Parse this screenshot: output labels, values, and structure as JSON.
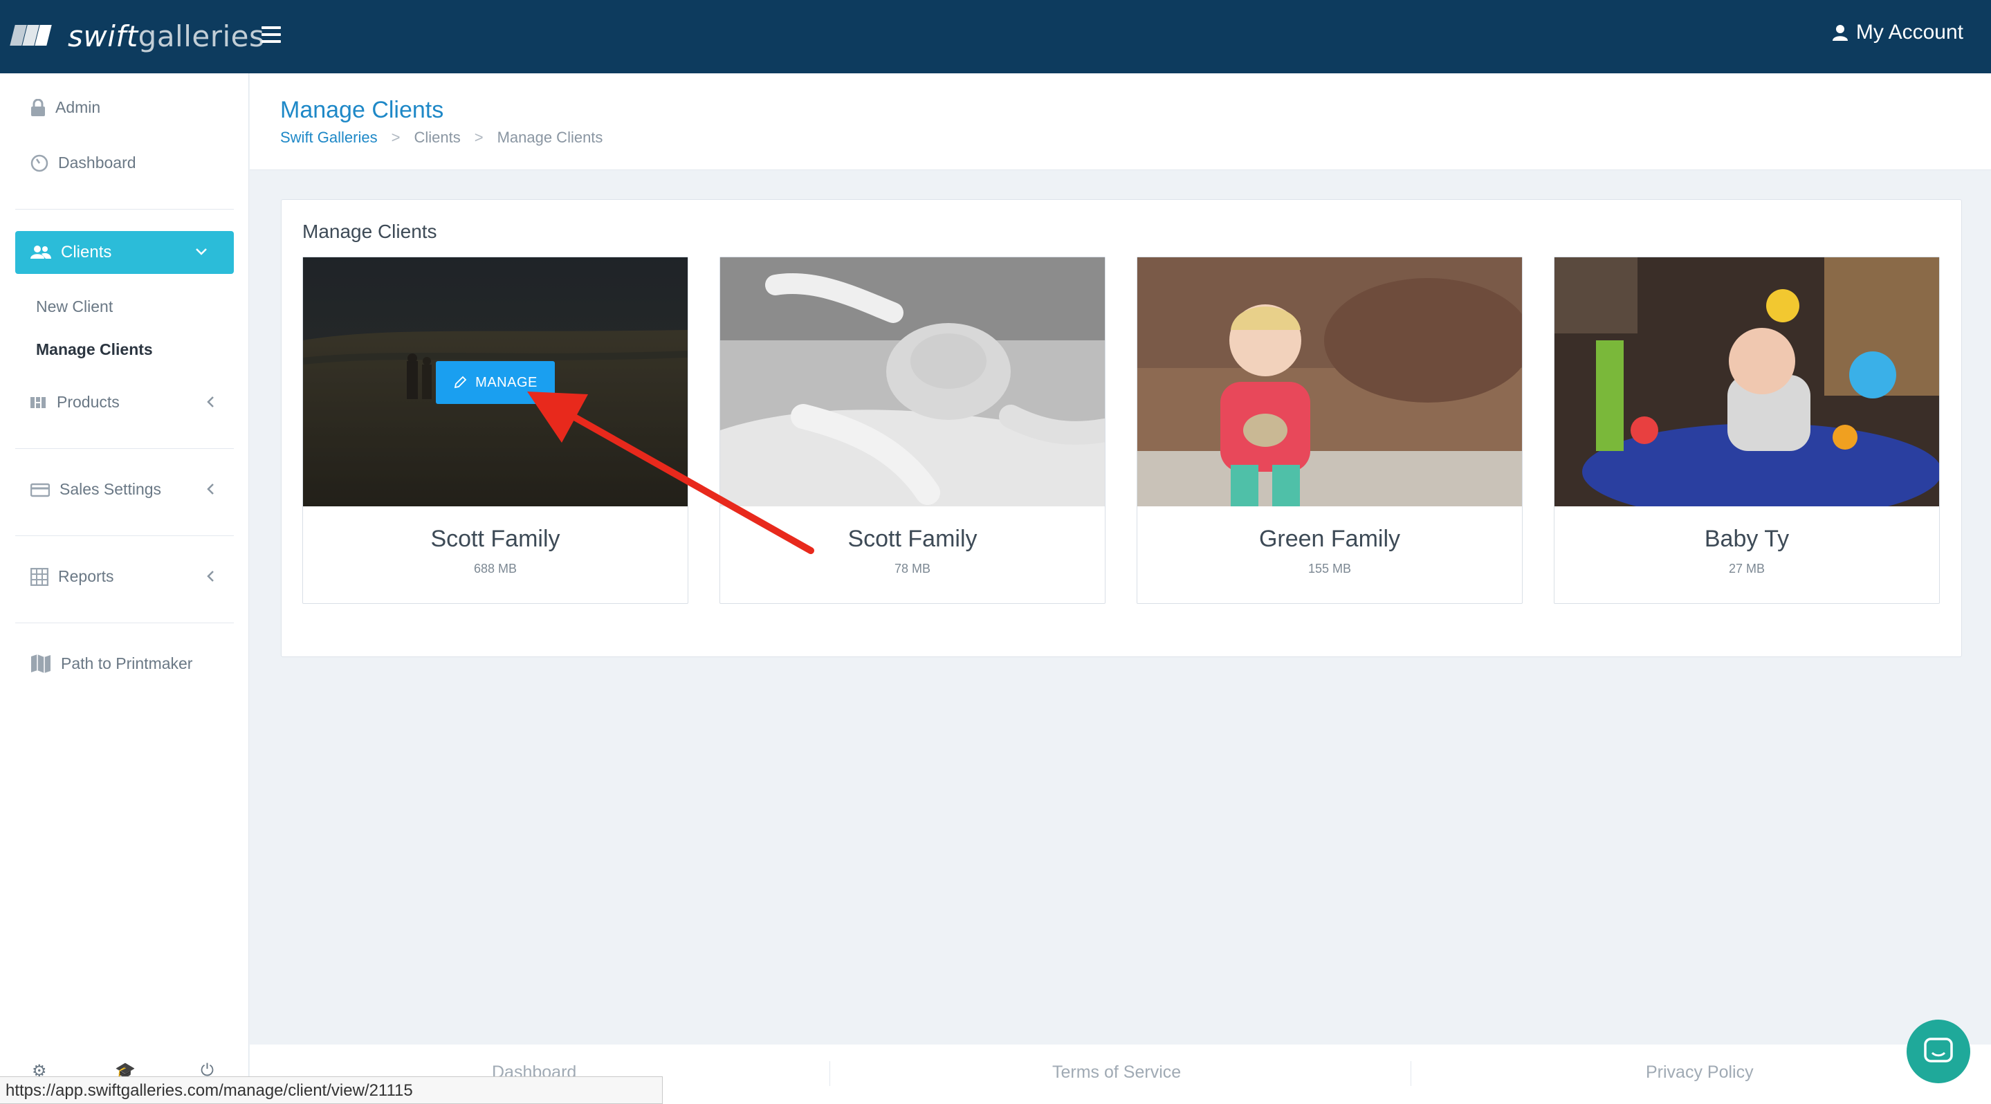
{
  "app": {
    "logo_bold": "swift",
    "logo_light": "galleries",
    "account_label": "My Account"
  },
  "sidebar": {
    "admin": "Admin",
    "dashboard": "Dashboard",
    "clients": "Clients",
    "new_client": "New Client",
    "manage_clients": "Manage Clients",
    "products": "Products",
    "sales_settings": "Sales Settings",
    "reports": "Reports",
    "path_to_printmaker": "Path to Printmaker"
  },
  "header": {
    "title": "Manage Clients",
    "breadcrumb": [
      "Swift Galleries",
      "Clients",
      "Manage Clients"
    ]
  },
  "panel": {
    "title": "Manage Clients",
    "manage_button": "MANAGE",
    "cards": [
      {
        "name": "Scott Family",
        "size": "688 MB"
      },
      {
        "name": "Scott Family",
        "size": "78 MB"
      },
      {
        "name": "Green Family",
        "size": "155 MB"
      },
      {
        "name": "Baby Ty",
        "size": "27 MB"
      }
    ]
  },
  "footer": {
    "links": [
      "Dashboard",
      "Terms of Service",
      "Privacy Policy"
    ]
  },
  "status_bar": {
    "url": "https://app.swiftgalleries.com/manage/client/view/21115"
  },
  "colors": {
    "topbar": "#0d3b5e",
    "accent": "#2bbcd9",
    "link": "#1e88c7",
    "manage_button": "#1a9ff0",
    "annotation_arrow": "#e8291c",
    "chat": "#1fa99a"
  },
  "icons": [
    "menu-icon",
    "user-icon",
    "lock-icon",
    "dashboard-icon",
    "users-icon",
    "products-icon",
    "sales-icon",
    "reports-icon",
    "map-icon",
    "pencil-icon",
    "chat-icon"
  ]
}
